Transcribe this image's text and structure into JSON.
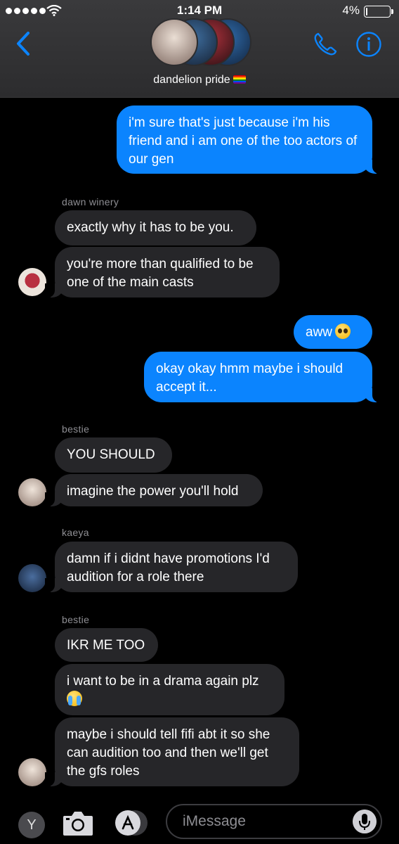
{
  "status": {
    "time": "1:14 PM",
    "battery": "4%"
  },
  "header": {
    "group_name": "dandelion pride",
    "avatar_colors": [
      "#d8c2b4",
      "#3a5f8a",
      "#8b2030",
      "#2e3c6a"
    ]
  },
  "messages": [
    {
      "dir": "out",
      "text": "i'm sure that's just because i'm his friend and i am one of the too actors of our gen"
    },
    {
      "sender": "dawn winery"
    },
    {
      "dir": "in",
      "text": "exactly why it has to be you."
    },
    {
      "dir": "in",
      "text": "you're more than qualified to be one of the main casts"
    },
    {
      "dir": "out",
      "text": "aww",
      "emoji": "pleading-face"
    },
    {
      "dir": "out",
      "text": "okay okay hmm maybe i should accept it..."
    },
    {
      "sender": "bestie"
    },
    {
      "dir": "in",
      "text": "YOU SHOULD"
    },
    {
      "dir": "in",
      "text": "imagine the power you'll hold"
    },
    {
      "sender": "kaeya"
    },
    {
      "dir": "in",
      "text": "damn if i didnt have promotions I'd audition for a role there"
    },
    {
      "sender": "bestie"
    },
    {
      "dir": "in",
      "text": "IKR ME TOO"
    },
    {
      "dir": "in",
      "text": "i want to be in a drama again plz",
      "emoji": "loudly-crying-face"
    },
    {
      "dir": "in",
      "text": "maybe i should tell fifi abt it so she can audition too and then we'll get the gfs roles"
    }
  ],
  "composer": {
    "app_button": "Y",
    "placeholder": "iMessage"
  },
  "colors": {
    "outgoing": "#0b84fe",
    "incoming": "#262629",
    "background": "#000000"
  }
}
